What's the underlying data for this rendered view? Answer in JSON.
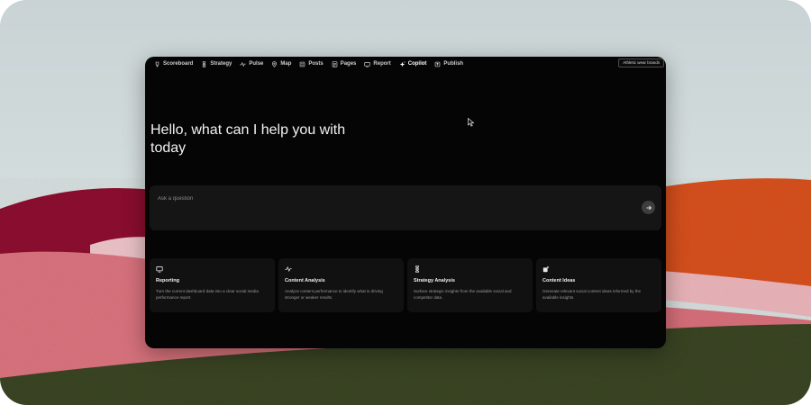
{
  "nav": {
    "items": [
      {
        "label": "Scoreboard",
        "icon": "trophy-icon"
      },
      {
        "label": "Strategy",
        "icon": "hourglass-icon"
      },
      {
        "label": "Pulse",
        "icon": "pulse-icon"
      },
      {
        "label": "Map",
        "icon": "map-pin-icon"
      },
      {
        "label": "Posts",
        "icon": "posts-icon"
      },
      {
        "label": "Pages",
        "icon": "pages-icon"
      },
      {
        "label": "Report",
        "icon": "report-icon"
      },
      {
        "label": "Copilot",
        "icon": "sparkle-icon",
        "active": true
      },
      {
        "label": "Publish",
        "icon": "publish-icon"
      }
    ],
    "brand_select": "Athletic wear brands"
  },
  "main": {
    "greeting": "Hello, what can I help you with today",
    "ask_placeholder": "Ask a question",
    "send_icon": "arrow-right-icon"
  },
  "cards": [
    {
      "title": "Reporting",
      "description": "Turn the current dashboard data into a clear social media performance report.",
      "icon": "monitor-icon"
    },
    {
      "title": "Content Analysis",
      "description": "Analyze content performance to identify what is driving stronger or weaker results.",
      "icon": "pulse-icon"
    },
    {
      "title": "Strategy Analysis",
      "description": "Surface strategic insights from the available social and competitor data.",
      "icon": "hourglass-icon"
    },
    {
      "title": "Content Ideas",
      "description": "Generate relevant social content ideas informed by the available insights.",
      "icon": "sparkle-box-icon"
    }
  ],
  "colors": {
    "panel_bg": "#050505",
    "card_bg": "#111111",
    "input_bg": "#151515",
    "send_button": "#3e3e3e",
    "paint_crimson": "#8c1230",
    "paint_pink": "#d9737e",
    "paint_orange": "#d6501c",
    "paint_olive": "#3a4524",
    "sky": "#cfd9da"
  }
}
